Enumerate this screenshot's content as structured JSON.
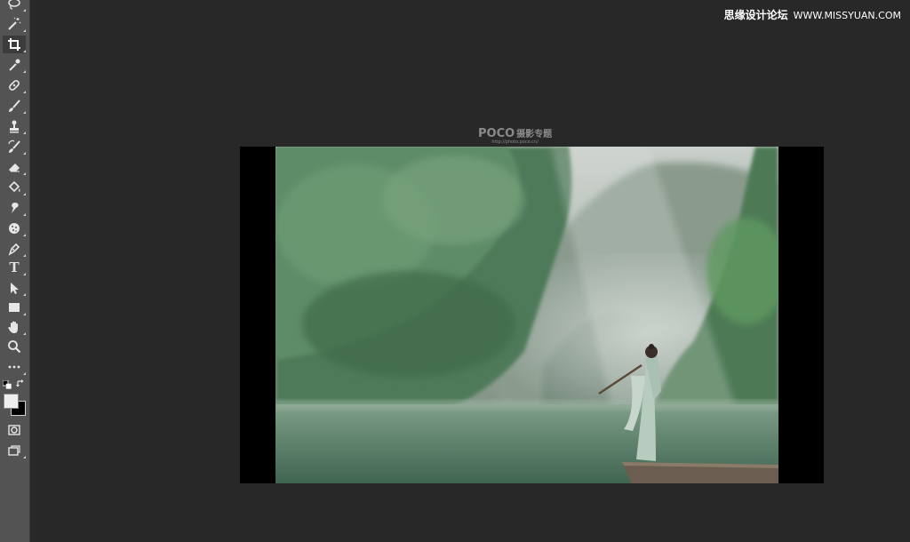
{
  "toolbar": {
    "tools": [
      {
        "id": "lasso",
        "icon": "lasso-icon"
      },
      {
        "id": "magic-wand",
        "icon": "magic-wand-icon"
      },
      {
        "id": "crop",
        "icon": "crop-icon"
      },
      {
        "id": "eyedropper",
        "icon": "eyedropper-icon"
      },
      {
        "id": "healing",
        "icon": "healing-brush-icon"
      },
      {
        "id": "brush",
        "icon": "brush-icon"
      },
      {
        "id": "stamp",
        "icon": "clone-stamp-icon"
      },
      {
        "id": "history-brush",
        "icon": "history-brush-icon"
      },
      {
        "id": "eraser",
        "icon": "eraser-icon"
      },
      {
        "id": "paint-bucket",
        "icon": "paint-bucket-icon"
      },
      {
        "id": "smudge",
        "icon": "smudge-icon"
      },
      {
        "id": "sponge",
        "icon": "sponge-icon"
      },
      {
        "id": "pen",
        "icon": "pen-icon"
      },
      {
        "id": "type",
        "icon": "type-icon"
      },
      {
        "id": "path-select",
        "icon": "path-selection-icon"
      },
      {
        "id": "rectangle",
        "icon": "rectangle-icon"
      },
      {
        "id": "hand",
        "icon": "hand-icon"
      },
      {
        "id": "zoom",
        "icon": "zoom-icon"
      },
      {
        "id": "more",
        "icon": "more-icon"
      }
    ],
    "type_label": "T",
    "foreground_color": "#eeeeee",
    "background_color": "#000000"
  },
  "watermark": {
    "site_cn": "思缘设计论坛",
    "site_url": "WWW.MISSYUAN.COM"
  },
  "document": {
    "logo_brand": "POCO",
    "logo_subtitle": "摄影专题",
    "logo_url": "http://photo.poco.cn/"
  }
}
